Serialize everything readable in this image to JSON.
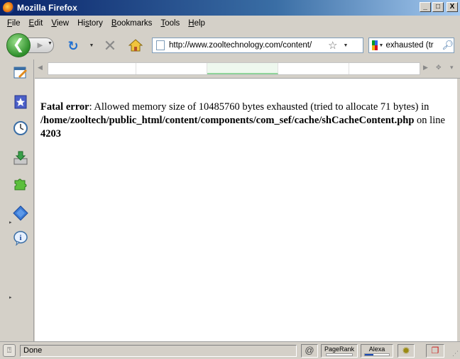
{
  "window": {
    "title": "Mozilla Firefox",
    "minimize": "_",
    "maximize": "□",
    "close": "X"
  },
  "menu": [
    {
      "key": "F",
      "rest": "ile"
    },
    {
      "key": "E",
      "rest": "dit"
    },
    {
      "key": "V",
      "rest": "iew"
    },
    {
      "pre": "Hi",
      "key": "s",
      "rest": "tory"
    },
    {
      "key": "B",
      "rest": "ookmarks"
    },
    {
      "key": "T",
      "rest": "ools"
    },
    {
      "key": "H",
      "rest": "elp"
    }
  ],
  "nav": {
    "url": "http://www.zooltechnology.com/content/",
    "search_value": "exhausted (tr",
    "icons": {
      "back": "back-arrow-icon",
      "forward": "forward-arrow-icon",
      "reload": "reload-icon",
      "stop": "stop-icon",
      "home": "home-icon",
      "bookmark_star": "star-icon",
      "search_engine": "google-icon",
      "search_go": "magnifier-icon"
    }
  },
  "sidebar_icons": [
    "page-edit-icon",
    "bookmarks-icon",
    "history-clock-icon",
    "downloads-icon",
    "addons-puzzle-icon",
    "extension-cross-icon",
    "info-icon"
  ],
  "error": {
    "label": "Fatal error",
    "message": ": Allowed memory size of 10485760 bytes exhausted (tried to allocate 71 bytes) in ",
    "path": "/home/zooltech/public_html/content/components/com_sef/cache/shCacheContent.php",
    "on_line": " on line ",
    "line": "4203"
  },
  "status": {
    "text": "Done",
    "pagerank_label": "PageRank",
    "pagerank_level": 0,
    "alexa_label": "Alexa",
    "alexa_level": 0.35
  },
  "colors": {
    "titlebar_start": "#0a246a",
    "titlebar_end": "#a6caf0",
    "chrome": "#d4d0c8",
    "back_button": "#2e8f2b",
    "link_accent": "#1f6fd1"
  }
}
